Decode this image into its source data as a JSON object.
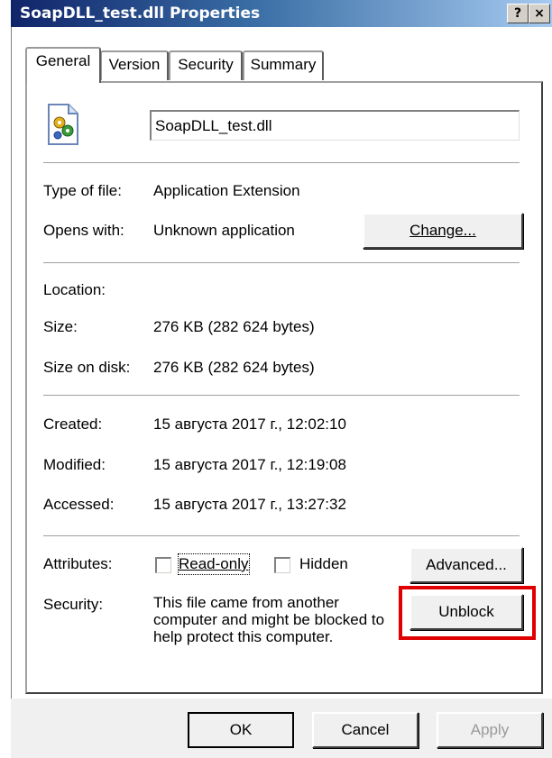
{
  "window": {
    "title": "SoapDLL_test.dll Properties",
    "help_button": "?",
    "close_button": "×"
  },
  "tabs": [
    {
      "label": "General"
    },
    {
      "label": "Version"
    },
    {
      "label": "Security"
    },
    {
      "label": "Summary"
    }
  ],
  "general": {
    "file_icon": "dll-file-icon",
    "file_name": "SoapDLL_test.dll",
    "type_label": "Type of file:",
    "type_value": "Application Extension",
    "opens_label": "Opens with:",
    "opens_value": "Unknown application",
    "change_button": "Change...",
    "location_label": "Location:",
    "location_value": "",
    "size_label": "Size:",
    "size_value": "276 KB (282 624 bytes)",
    "size_on_disk_label": "Size on disk:",
    "size_on_disk_value": "276 KB (282 624 bytes)",
    "created_label": "Created:",
    "created_value": "15 августа 2017 г., 12:02:10",
    "modified_label": "Modified:",
    "modified_value": "15 августа 2017 г., 12:19:08",
    "accessed_label": "Accessed:",
    "accessed_value": "15 августа 2017 г., 13:27:32",
    "attributes_label": "Attributes:",
    "readonly_label": "Read-only",
    "hidden_label": "Hidden",
    "advanced_button": "Advanced...",
    "security_label": "Security:",
    "security_text_1": "This file came from another",
    "security_text_2": "computer and might be blocked to",
    "security_text_3": "help protect this computer.",
    "unblock_button": "Unblock"
  },
  "footer": {
    "ok_button": "OK",
    "cancel_button": "Cancel",
    "apply_button": "Apply"
  },
  "colors": {
    "highlight": "#e00000",
    "titlebar_start": "#10246a",
    "titlebar_end": "#a6caf0"
  }
}
